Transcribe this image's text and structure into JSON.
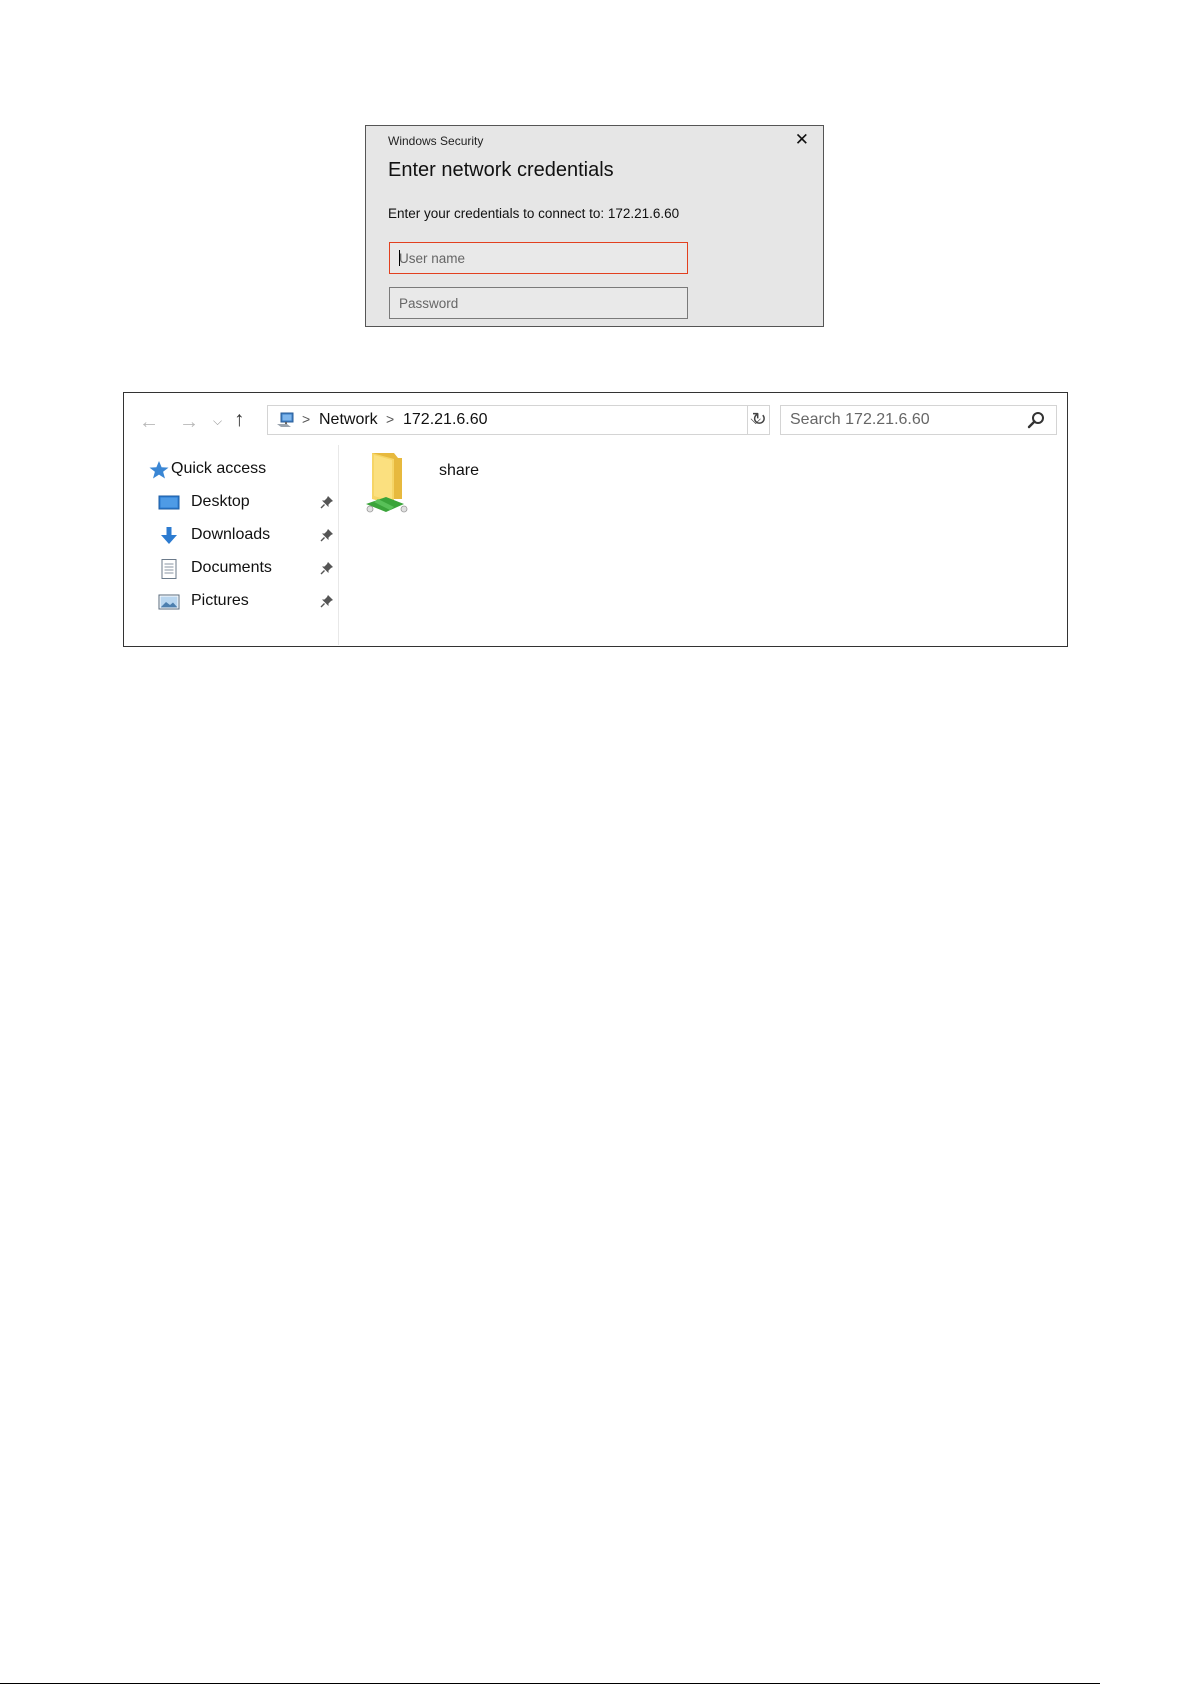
{
  "credentials_dialog": {
    "caption": "Windows Security",
    "heading": "Enter network credentials",
    "message": "Enter your credentials to connect to: 172.21.6.60",
    "username_placeholder": "User name",
    "username_value": "",
    "password_placeholder": "Password",
    "password_value": "",
    "close_icon": "close-icon",
    "colors": {
      "background": "#e6e6e6",
      "focus_border": "#e2401f"
    }
  },
  "explorer": {
    "address": {
      "crumbs": [
        "Network",
        "172.21.6.60"
      ]
    },
    "search": {
      "placeholder": "Search 172.21.6.60"
    },
    "sidebar": {
      "items": [
        {
          "label": "Quick access",
          "icon": "star-icon"
        },
        {
          "label": "Desktop",
          "icon": "desktop-icon",
          "pinned": true
        },
        {
          "label": "Downloads",
          "icon": "download-icon",
          "pinned": true
        },
        {
          "label": "Documents",
          "icon": "document-icon",
          "pinned": true
        },
        {
          "label": "Pictures",
          "icon": "pictures-icon",
          "pinned": true
        }
      ]
    },
    "content": {
      "items": [
        {
          "label": "share",
          "icon": "shared-folder-icon"
        }
      ]
    }
  }
}
